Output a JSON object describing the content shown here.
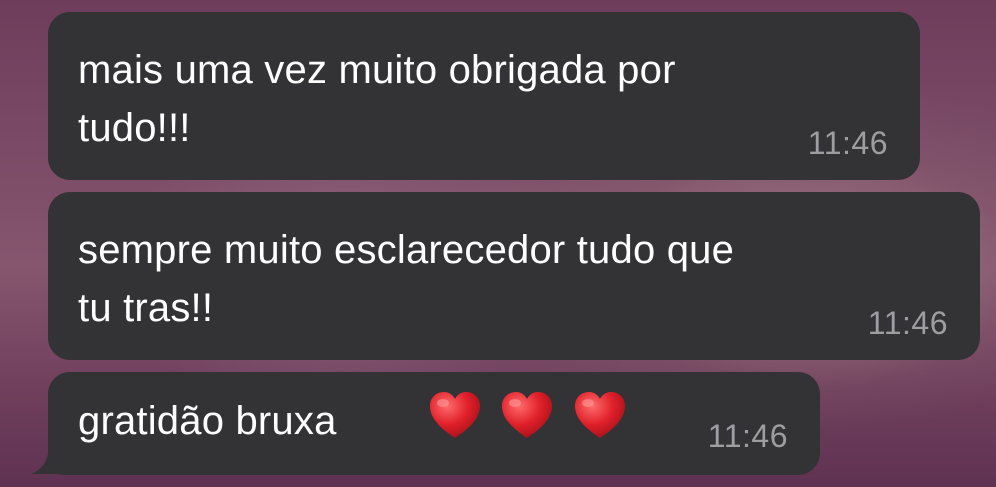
{
  "chat": {
    "messages": [
      {
        "text": "mais uma vez muito obrigada por\ntudo!!!",
        "time": "11:46"
      },
      {
        "text": "sempre muito esclarecedor tudo que\ntu tras!!",
        "time": "11:46"
      },
      {
        "text": "gratidão bruxa",
        "emojis": [
          "red-heart",
          "red-heart",
          "red-heart"
        ],
        "time": "11:46"
      }
    ]
  },
  "colors": {
    "bubble": "#333335",
    "message_text": "#ffffff",
    "timestamp_text": "#9d9da2",
    "heart": "#e0202a",
    "wallpaper": "#7a4a66"
  }
}
